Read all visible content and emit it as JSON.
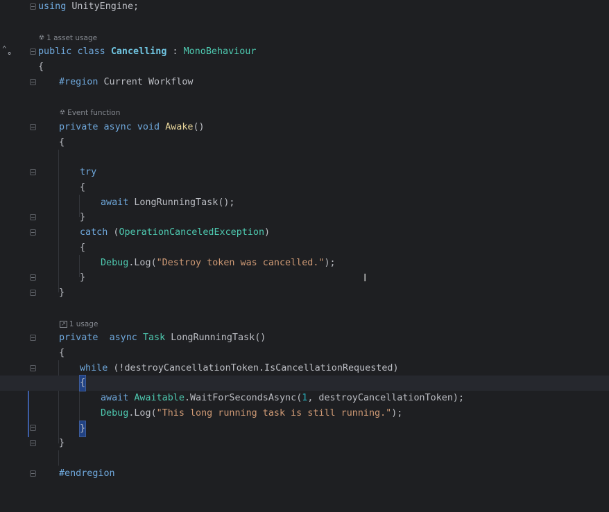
{
  "editor": {
    "lines": {
      "using_kw": "using",
      "using_ns": " UnityEngine;",
      "hint_asset_usage": "1 asset usage",
      "class_public": "public",
      "class_class": "class",
      "class_name": "Cancelling",
      "class_colon": " : ",
      "class_base": "MonoBehaviour",
      "open_brace": "{",
      "region_kw": "#region",
      "region_name": " Current Workflow",
      "hint_event_function": "Event function",
      "awake_private": "private",
      "awake_async": "async",
      "awake_void": "void",
      "awake_name": "Awake",
      "awake_parens": "()",
      "awake_open": "{",
      "try_kw": "try",
      "try_open": "{",
      "await_kw": "await",
      "await_call": "LongRunningTask",
      "await_tail": "();",
      "try_close": "}",
      "catch_kw": "catch",
      "catch_open_paren": " (",
      "catch_type": "OperationCanceledException",
      "catch_close_paren": ")",
      "catch_open": "{",
      "debug_obj": "Debug",
      "debug_dot": ".",
      "debug_method": "Log",
      "debug_open": "(",
      "debug_string1": "\"Destroy token was cancelled.\"",
      "debug_close": ");",
      "catch_close": "}",
      "awake_close": "}",
      "hint_usage": "1 usage",
      "lrt_private": "private",
      "lrt_async": "async",
      "lrt_task": "Task",
      "lrt_name": "LongRunningTask",
      "lrt_parens": "()",
      "lrt_open": "{",
      "while_kw": "while",
      "while_cond": " (!destroyCancellationToken.IsCancellationRequested)",
      "while_open": "{",
      "await2_kw": "await",
      "await2_type": "Awaitable",
      "await2_dot": ".",
      "await2_method": "WaitForSecondsAsync",
      "await2_open": "(",
      "await2_num": "1",
      "await2_rest": ", destroyCancellationToken);",
      "debug2_obj": "Debug",
      "debug2_dot": ".",
      "debug2_method": "Log",
      "debug2_open": "(",
      "debug_string2": "\"This long running task is still running.\"",
      "debug2_close": ");",
      "while_close": "}",
      "lrt_close": "}",
      "endregion_kw": "#endregion"
    }
  },
  "icons": {
    "hint_unity": "unity-icon",
    "hint_usage": "usage-link-icon",
    "bulb": "lightbulb-icon",
    "nav": "navigate-up-icon",
    "gear": "override-icon",
    "cursor": "text-cursor-icon"
  },
  "colors": {
    "background": "#1e1f22",
    "keyword": "#cf8e6d",
    "type": "#4ec9b0",
    "method": "#56a8f5",
    "string": "#cf9a75",
    "current_line": "#26282e",
    "selection": "#214283"
  }
}
